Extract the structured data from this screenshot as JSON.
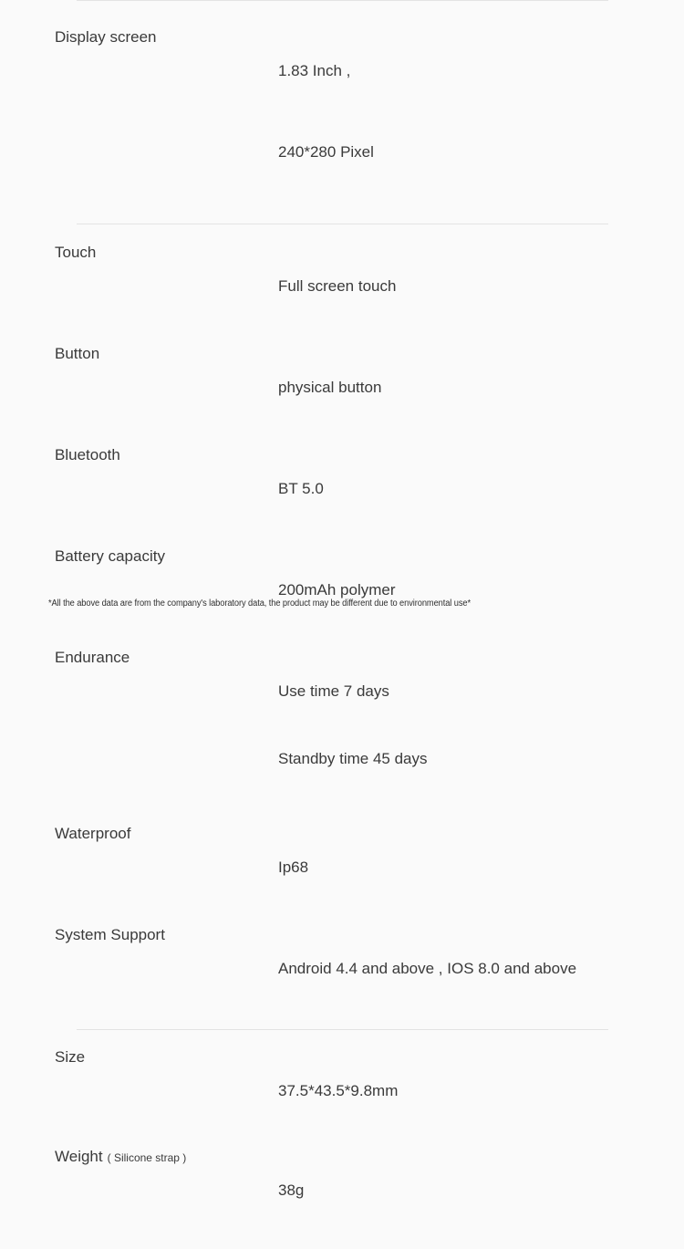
{
  "page": {
    "background_color": "#fafafa",
    "text_color": "#3a3a3a",
    "divider_color": "#e3e3e3"
  },
  "sections": [
    {
      "name": "display",
      "rows": [
        {
          "label": "Display screen",
          "value_lines": [
            "1.83 Inch ,",
            "240*280 Pixel"
          ]
        }
      ]
    },
    {
      "name": "main",
      "rows": [
        {
          "label": "Touch",
          "value_lines": [
            "Full screen touch"
          ]
        },
        {
          "label": "Button",
          "value_lines": [
            "physical button"
          ]
        },
        {
          "label": "Bluetooth",
          "value_lines": [
            "BT 5.0"
          ]
        },
        {
          "label": "Battery capacity",
          "value_lines": [
            "200mAh polymer"
          ]
        },
        {
          "label": "Endurance",
          "value_lines": [
            "Use time 7 days",
            "Standby time 45 days"
          ]
        },
        {
          "label": "Waterproof",
          "value_lines": [
            "Ip68"
          ]
        },
        {
          "label": "System Support",
          "value_lines": [
            "Android 4.4 and above , IOS 8.0 and above"
          ]
        }
      ]
    },
    {
      "name": "size",
      "rows": [
        {
          "label": "Size",
          "value_lines": [
            "37.5*43.5*9.8mm"
          ]
        },
        {
          "label": "Weight",
          "label_sub": "( Silicone strap )",
          "value_lines": [
            "38g"
          ]
        }
      ]
    }
  ],
  "footnote": {
    "text": "*All the above data are from the company's laboratory data, the product may be different due to environmental use*"
  }
}
